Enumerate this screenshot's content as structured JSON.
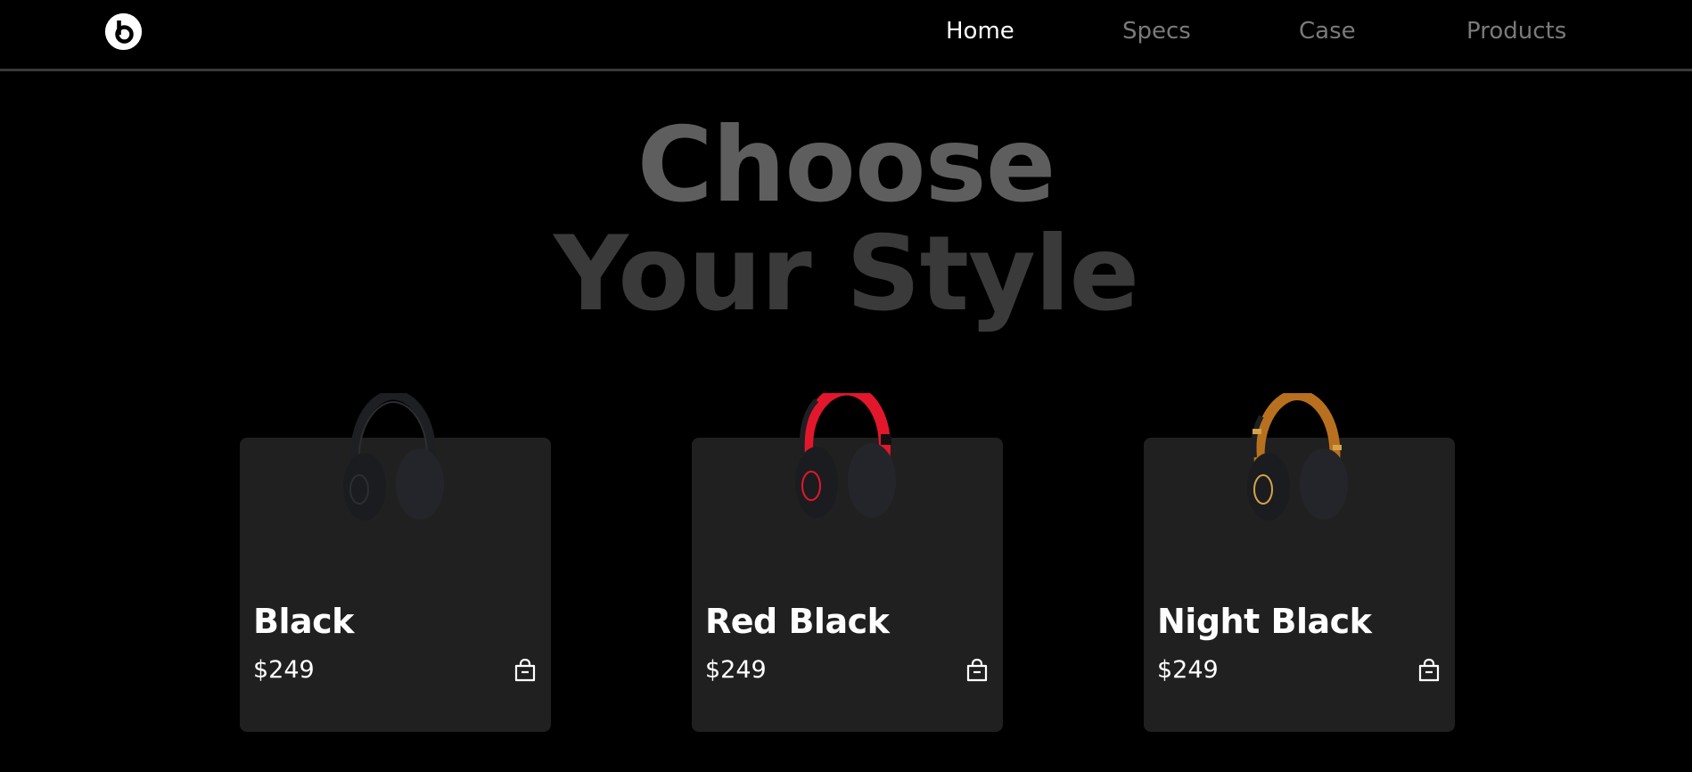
{
  "brand": {
    "logo_icon": "beats-logo-icon"
  },
  "nav": {
    "items": [
      {
        "label": "Home",
        "active": true
      },
      {
        "label": "Specs",
        "active": false
      },
      {
        "label": "Case",
        "active": false
      },
      {
        "label": "Products",
        "active": false
      }
    ]
  },
  "hero": {
    "line1": "Choose",
    "line2": "Your Style"
  },
  "products": [
    {
      "name": "Black",
      "price": "$249",
      "icon": "headphones-black-icon",
      "band_color": "#1e1f22",
      "cup_color": "#1b1c1f",
      "accent": "#2d2e32"
    },
    {
      "name": "Red Black",
      "price": "$249",
      "icon": "headphones-red-black-icon",
      "band_color": "#e3172b",
      "cup_color": "#1b1c1f",
      "accent": "#e3172b"
    },
    {
      "name": "Night Black",
      "price": "$249",
      "icon": "headphones-night-black-icon",
      "band_color": "#b8701f",
      "cup_color": "#1b1c1f",
      "accent": "#d4a24a"
    }
  ],
  "colors": {
    "background": "#000000",
    "card": "#202020",
    "nav_inactive": "#7a7a7a",
    "nav_active": "#ffffff"
  }
}
